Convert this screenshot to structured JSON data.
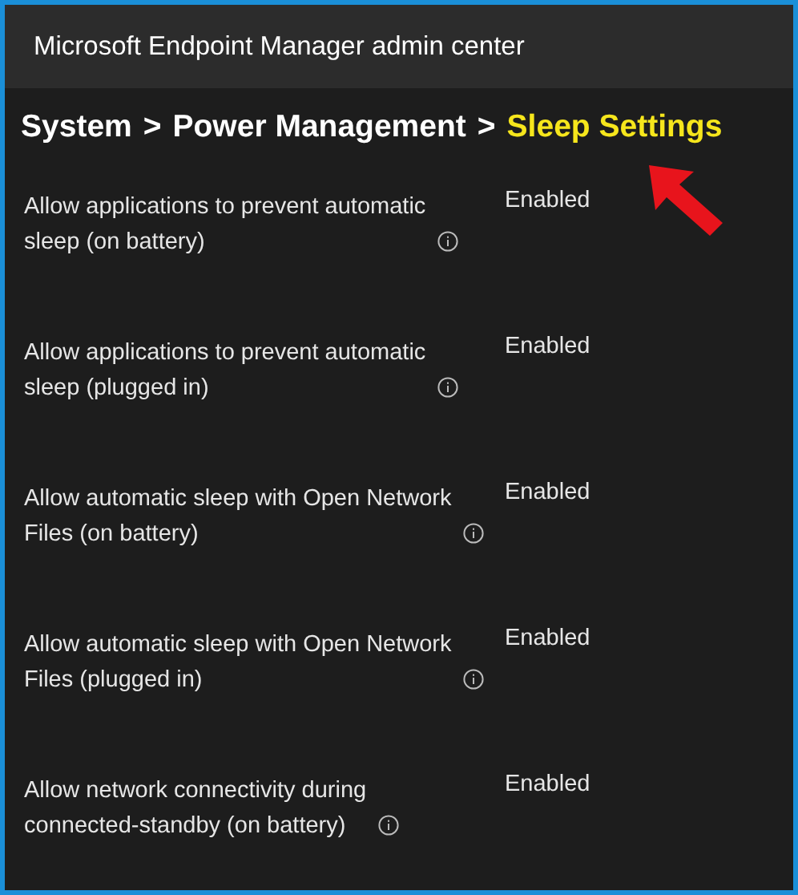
{
  "window": {
    "title": "Microsoft Endpoint Manager admin center"
  },
  "breadcrumb": [
    {
      "label": "System",
      "current": false
    },
    {
      "label": ">",
      "current": false
    },
    {
      "label": "Power Management",
      "current": false
    },
    {
      "label": ">",
      "current": false
    },
    {
      "label": "Sleep Settings",
      "current": true
    }
  ],
  "settings": [
    {
      "label": "Allow applications to prevent automatic sleep (on battery)",
      "value": "Enabled"
    },
    {
      "label": "Allow applications to prevent automatic sleep (plugged in)",
      "value": "Enabled"
    },
    {
      "label": "Allow automatic sleep with Open Network Files (on battery)",
      "value": "Enabled"
    },
    {
      "label": "Allow automatic sleep with Open Network Files (plugged in)",
      "value": "Enabled"
    },
    {
      "label": "Allow network connectivity during connected-standby (on battery)",
      "value": "Enabled"
    }
  ]
}
